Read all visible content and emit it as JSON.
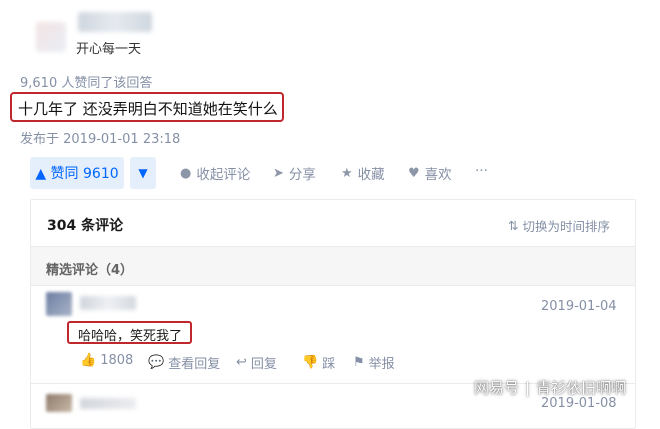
{
  "author": {
    "bio": "开心每一天"
  },
  "answer": {
    "upvote_summary": "9,610 人赞同了该回答",
    "text": "十几年了 还没弄明白不知道她在笑什么",
    "published": "发布于 2019-01-01 23:18"
  },
  "actions": {
    "upvote_label": "▲ 赞同 9610",
    "downvote_label": "▼",
    "collapse_comments": "收起评论",
    "share": "分享",
    "favorite": "收藏",
    "like": "喜欢",
    "more": "···"
  },
  "comments": {
    "count_label": "304 条评论",
    "sort_toggle": "切换为时间排序",
    "featured_label": "精选评论（4）",
    "items": [
      {
        "time": "2019-01-04",
        "text": "哈哈哈，笑死我了",
        "likes": "1808",
        "view_replies": "查看回复",
        "reply": "回复",
        "dislike": "踩",
        "report": "举报"
      },
      {
        "time": "2019-01-08"
      }
    ]
  },
  "watermark": {
    "site": "网易号",
    "account": "青衫依旧啊啊"
  },
  "colors": {
    "accent": "#0066ff",
    "highlight_border": "#c0272d",
    "muted": "#8590a6"
  },
  "icons": [
    "comment-icon",
    "share-icon",
    "star-icon",
    "heart-icon",
    "more-icon",
    "sort-icon",
    "thumbs-up-icon",
    "replies-icon",
    "reply-icon",
    "thumbs-down-icon",
    "flag-icon"
  ]
}
